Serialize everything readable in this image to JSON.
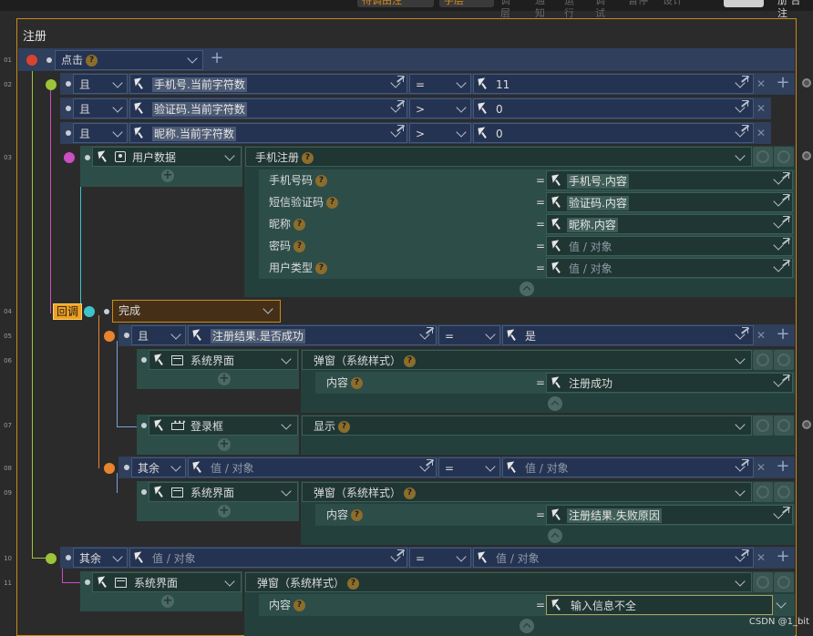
{
  "topbar": {
    "items": [
      "待调由注",
      "手层",
      "调层",
      "通知",
      "运行",
      "调试",
      "暂停",
      "设计"
    ],
    "status": "册 台注"
  },
  "panel": {
    "title": "注册"
  },
  "line_numbers": [
    "01",
    "02",
    "03",
    "04",
    "05",
    "06",
    "07",
    "08",
    "09",
    "10",
    "11"
  ],
  "rows": {
    "r01": {
      "event": "点击"
    },
    "r02": {
      "logic": "且",
      "left": "手机号.当前字符数",
      "op": "=",
      "right": "11"
    },
    "r02b": {
      "logic": "且",
      "left": "验证码.当前字符数",
      "op": ">",
      "right": "0"
    },
    "r02c": {
      "logic": "且",
      "left": "昵称.当前字符数",
      "op": ">",
      "right": "0"
    },
    "r03": {
      "target": "用户数据",
      "action": "手机注册",
      "params": [
        {
          "label": "手机号码",
          "op": "=",
          "value": "手机号.内容",
          "placeholder": false
        },
        {
          "label": "短信验证码",
          "op": "=",
          "value": "验证码.内容",
          "placeholder": false
        },
        {
          "label": "昵称",
          "op": "=",
          "value": "昵称.内容",
          "placeholder": false
        },
        {
          "label": "密码",
          "op": "=",
          "value": "值 / 对象",
          "placeholder": true
        },
        {
          "label": "用户类型",
          "op": "=",
          "value": "值 / 对象",
          "placeholder": true
        }
      ]
    },
    "r04": {
      "tag": "回调",
      "event": "完成"
    },
    "r05": {
      "logic": "且",
      "left": "注册结果.是否成功",
      "op": "=",
      "right": "是"
    },
    "r06": {
      "target": "系统界面",
      "action": "弹窗（系统样式）",
      "param_label": "内容",
      "op": "=",
      "value": "注册成功"
    },
    "r07": {
      "target": "登录框",
      "action": "显示"
    },
    "r08": {
      "logic": "其余",
      "left": "值 / 对象",
      "op": "=",
      "right": "值 / 对象"
    },
    "r09": {
      "target": "系统界面",
      "action": "弹窗（系统样式）",
      "param_label": "内容",
      "op": "=",
      "value": "注册结果.失败原因"
    },
    "r10": {
      "logic": "其余",
      "left": "值 / 对象",
      "op": "=",
      "right": "值 / 对象"
    },
    "r11": {
      "target": "系统界面",
      "action": "弹窗（系统样式）",
      "param_label": "内容",
      "op": "=",
      "value": "输入信息不全"
    }
  },
  "watermark": "CSDN @1_bit",
  "colors": {
    "accent": "#c88a1e",
    "navy": "#2f3f5c",
    "teal": "#24403c",
    "red_dot": "#d9432f",
    "green_dot": "#9bc43a",
    "magenta_dot": "#c94fc2",
    "cyan_dot": "#3fc3c9",
    "orange_dot": "#e8842e"
  }
}
